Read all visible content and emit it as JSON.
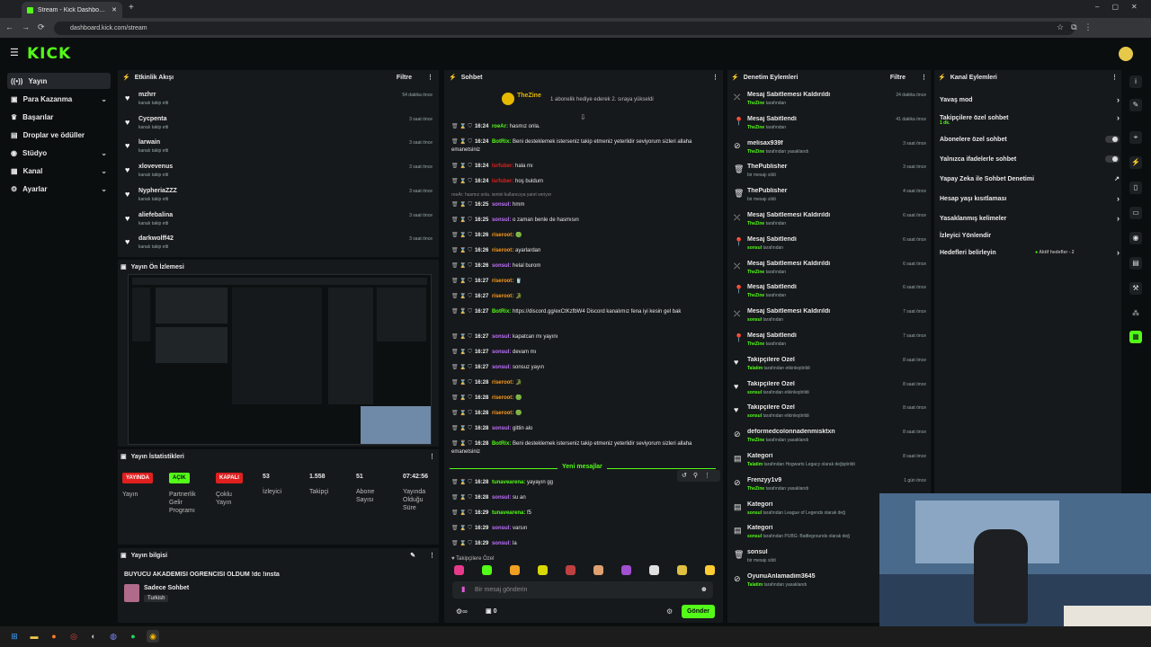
{
  "browser": {
    "tab_title": "Stream - Kick Dashboard",
    "url": "dashboard.kick.com/stream"
  },
  "brand": {
    "logo": "KICK",
    "accent": "#53fc18"
  },
  "sidebar": {
    "items": [
      {
        "label": "Yayın",
        "icon": "broadcast-icon",
        "active": true
      },
      {
        "label": "Para Kazanma",
        "icon": "money-icon",
        "chevron": true
      },
      {
        "label": "Başarılar",
        "icon": "trophy-icon"
      },
      {
        "label": "Droplar ve ödüller",
        "icon": "gift-icon"
      },
      {
        "label": "Stüdyo",
        "icon": "studio-icon",
        "chevron": true
      },
      {
        "label": "Kanal",
        "icon": "channel-icon",
        "chevron": true
      },
      {
        "label": "Ayarlar",
        "icon": "gear-icon",
        "chevron": true
      }
    ]
  },
  "activity": {
    "title": "Etkinlik Akışı",
    "filter": "Filtre",
    "items": [
      {
        "name": "mzhrr",
        "sub": "kanalı takip etti",
        "time": "54 dakika önce"
      },
      {
        "name": "Cycpenta",
        "sub": "kanalı takip etti",
        "time": "3 saat önce"
      },
      {
        "name": "larwain",
        "sub": "kanalı takip etti",
        "time": "3 saat önce"
      },
      {
        "name": "xlovevenus",
        "sub": "kanalı takip etti",
        "time": "3 saat önce"
      },
      {
        "name": "NypheriaZZZ",
        "sub": "kanalı takip etti",
        "time": "3 saat önce"
      },
      {
        "name": "aliefebalina",
        "sub": "kanalı takip etti",
        "time": "3 saat önce"
      },
      {
        "name": "darkwolff42",
        "sub": "kanalı takip etti",
        "time": "3 saat önce"
      }
    ]
  },
  "preview": {
    "title": "Yayın Ön İzlemesi"
  },
  "stats": {
    "title": "Yayın İstatistikleri",
    "items": [
      {
        "tag": "YAYINDA",
        "label": "Yayın",
        "tag_color": "#e0201f"
      },
      {
        "tag": "AÇIK",
        "label": "Partnerlik Gelir Programı",
        "tag_color": "#53fc18"
      },
      {
        "tag": "KAPALI",
        "label": "Çoklu Yayın",
        "tag_color": "#e0201f"
      },
      {
        "value": "53",
        "label": "İzleyici"
      },
      {
        "value": "1.558",
        "label": "Takipçi"
      },
      {
        "value": "51",
        "label": "Abone Sayısı"
      },
      {
        "value": "07:42:56",
        "label": "Yayında Olduğu Süre"
      }
    ]
  },
  "info": {
    "title": "Yayın bilgisi",
    "stream_title": "BÜYÜCÜ AKADEMİSİ ÖĞRENCİSİ OLDUM !dc !insta",
    "category": "Sadece Sohbet",
    "language": "Turkish"
  },
  "chat": {
    "title": "Sohbet",
    "pinned_user": "TheZine",
    "pinned_text": "1 abonelik hediye ederek 2. sıraya yükseldi",
    "new_messages": "Yeni mesajlar",
    "followers_only": "Takipçilere Özel",
    "input_placeholder": "Bir mesaj gönderin",
    "send": "Gönder",
    "counter": "0",
    "messages": [
      {
        "time": "16:24",
        "user": "roeAr",
        "color": "#53fc18",
        "text": "hasmız onla."
      },
      {
        "time": "16:24",
        "user": "BotRix",
        "color": "#53fc18",
        "text": "Beni desteklemek isterseniz takip etmeniz yeterlidir seviyorum sizleri allaha emanetsiniz"
      },
      {
        "time": "16:24",
        "user": "lsrfuber",
        "color": "#e0201f",
        "text": "hala mı"
      },
      {
        "time": "16:24",
        "user": "lsrfuber",
        "color": "#e0201f",
        "text": "hoş buldum"
      },
      {
        "time": "",
        "user": "",
        "color": "#888",
        "text": "roeAr: hasmız onla. ismini kullanıcıya yanıt veriyor"
      },
      {
        "time": "16:25",
        "user": "sonsul",
        "color": "#c070ff",
        "text": "hmm"
      },
      {
        "time": "16:25",
        "user": "sonsul",
        "color": "#c070ff",
        "text": "o zaman benle de hasmısın"
      },
      {
        "time": "16:26",
        "user": "riseroot",
        "color": "#ff9a1a",
        "text": "🟢"
      },
      {
        "time": "16:26",
        "user": "riseroot",
        "color": "#ff9a1a",
        "text": "ayarlardan"
      },
      {
        "time": "16:26",
        "user": "sonsul",
        "color": "#c070ff",
        "text": "helal burom"
      },
      {
        "time": "16:27",
        "user": "riseroot",
        "color": "#ff9a1a",
        "text": "🥤"
      },
      {
        "time": "16:27",
        "user": "riseroot",
        "color": "#ff9a1a",
        "text": "🐊"
      },
      {
        "time": "16:27",
        "user": "BotRix",
        "color": "#53fc18",
        "text": "https://discord.gg/exCtKzfbW4 Discord kanalımız fena iyi kesin gel bak"
      },
      {
        "time": "16:27",
        "user": "sonsul",
        "color": "#c070ff",
        "text": "kapatcan mı yayını"
      },
      {
        "time": "16:27",
        "user": "sonsul",
        "color": "#c070ff",
        "text": "devam mı"
      },
      {
        "time": "16:27",
        "user": "sonsul",
        "color": "#c070ff",
        "text": "sonsuz yayın"
      },
      {
        "time": "16:28",
        "user": "riseroot",
        "color": "#ff9a1a",
        "text": "🐊"
      },
      {
        "time": "16:28",
        "user": "riseroot",
        "color": "#ff9a1a",
        "text": "🟢"
      },
      {
        "time": "16:28",
        "user": "riseroot",
        "color": "#ff9a1a",
        "text": "🟢"
      },
      {
        "time": "16:28",
        "user": "sonsul",
        "color": "#c070ff",
        "text": "gittin alo"
      },
      {
        "time": "16:28",
        "user": "BotRix",
        "color": "#53fc18",
        "text": "Beni desteklemek isterseniz takip etmeniz yeterlidir seviyorum sizleri allaha emanetsiniz"
      },
      {
        "time": "16:28",
        "user": "tunavearena",
        "color": "#53fc18",
        "text": "yayayın gg"
      },
      {
        "time": "16:28",
        "user": "sonsul",
        "color": "#c070ff",
        "text": "su an"
      },
      {
        "time": "16:29",
        "user": "tunavearena",
        "color": "#53fc18",
        "text": "f5"
      },
      {
        "time": "16:29",
        "user": "sonsul",
        "color": "#c070ff",
        "text": "varsın"
      },
      {
        "time": "16:29",
        "user": "sonsul",
        "color": "#c070ff",
        "text": "la"
      }
    ]
  },
  "moderation": {
    "title": "Denetim Eylemleri",
    "filter": "Filtre",
    "items": [
      {
        "icon": "unpin-icon",
        "name": "Mesaj Sabitlemesi Kaldırıldı",
        "who": "TheZine",
        "sub": "tarafından",
        "time": "24 dakika önce"
      },
      {
        "icon": "pin-icon",
        "name": "Mesaj Sabitlendi",
        "who": "TheZine",
        "sub": "tarafından",
        "time": "41 dakika önce"
      },
      {
        "icon": "ban-icon",
        "name": "melisax939f",
        "who": "TheZine",
        "sub": "tarafından yasaklandı",
        "time": "3 saat önce"
      },
      {
        "icon": "trash-icon",
        "name": "ThePublisher",
        "who": "",
        "sub": "bir mesajı sildi",
        "time": "3 saat önce"
      },
      {
        "icon": "trash-icon",
        "name": "ThePublisher",
        "who": "",
        "sub": "bir mesajı sildi",
        "time": "4 saat önce"
      },
      {
        "icon": "unpin-icon",
        "name": "Mesaj Sabitlemesi Kaldırıldı",
        "who": "TheZine",
        "sub": "tarafından",
        "time": "6 saat önce"
      },
      {
        "icon": "pin-icon",
        "name": "Mesaj Sabitlendi",
        "who": "sonsul",
        "sub": "tarafından",
        "time": "6 saat önce"
      },
      {
        "icon": "unpin-icon",
        "name": "Mesaj Sabitlemesi Kaldırıldı",
        "who": "TheZine",
        "sub": "tarafından",
        "time": "6 saat önce"
      },
      {
        "icon": "pin-icon",
        "name": "Mesaj Sabitlendi",
        "who": "TheZine",
        "sub": "tarafından",
        "time": "6 saat önce"
      },
      {
        "icon": "unpin-icon",
        "name": "Mesaj Sabitlemesi Kaldırıldı",
        "who": "sonsul",
        "sub": "tarafından",
        "time": "7 saat önce"
      },
      {
        "icon": "pin-icon",
        "name": "Mesaj Sabitlendi",
        "who": "TheZine",
        "sub": "tarafından",
        "time": "7 saat önce"
      },
      {
        "icon": "heart-icon",
        "name": "Takipçilere Özel",
        "who": "Talatim",
        "sub": "tarafından etkinleştirildi",
        "time": "8 saat önce"
      },
      {
        "icon": "heart-icon",
        "name": "Takipçilere Özel",
        "who": "sonsul",
        "sub": "tarafından etkinleştirildi",
        "time": "8 saat önce"
      },
      {
        "icon": "heart-icon",
        "name": "Takipçilere Özel",
        "who": "sonsul",
        "sub": "tarafından etkinleştirildi",
        "time": "8 saat önce"
      },
      {
        "icon": "ban-icon",
        "name": "deformedcolonnadenmisktxn",
        "who": "TheZine",
        "sub": "tarafından yasaklandı",
        "time": "8 saat önce"
      },
      {
        "icon": "category-icon",
        "name": "Kategori",
        "who": "Talatim",
        "sub": "tarafından Hogwarts Legacy olarak değiştirildi",
        "time": "8 saat önce"
      },
      {
        "icon": "ban-icon",
        "name": "Frenzyy1v9",
        "who": "TheZine",
        "sub": "tarafından yasaklandı",
        "time": "1 gün önce"
      },
      {
        "icon": "category-icon",
        "name": "Kategori",
        "who": "sonsul",
        "sub": "tarafından League of Legends olarak değ",
        "time": ""
      },
      {
        "icon": "category-icon",
        "name": "Kategori",
        "who": "sonsul",
        "sub": "tarafından PUBG: Battlegrounds olarak değ",
        "time": ""
      },
      {
        "icon": "trash-icon",
        "name": "sonsul",
        "who": "",
        "sub": "bir mesajı sildi",
        "time": ""
      },
      {
        "icon": "ban-icon",
        "name": "OyunuAnlamadim3645",
        "who": "Talatim",
        "sub": "tarafından yasaklandı",
        "time": ""
      }
    ]
  },
  "channel_actions": {
    "title": "Kanal Eylemleri",
    "items": [
      {
        "label": "Yavaş mod",
        "control": "chevron"
      },
      {
        "label": "Takipçilere özel sohbet",
        "sub": "1 dk.",
        "control": "chevron"
      },
      {
        "label": "Abonelere özel sohbet",
        "control": "toggle"
      },
      {
        "label": "Yalnızca ifadelerle sohbet",
        "control": "toggle"
      },
      {
        "label": "Yapay Zeka ile Sohbet Denetimi",
        "control": "external"
      },
      {
        "label": "Hesap yaşı kısıtlaması",
        "control": "chevron"
      },
      {
        "label": "Yasaklanmış kelimeler",
        "control": "chevron"
      },
      {
        "label": "İzleyici Yönlendir",
        "control": "none"
      },
      {
        "label": "Hedefleri belirleyin",
        "control": "chevron",
        "badge": "Aktif hedefler - 2"
      }
    ]
  }
}
